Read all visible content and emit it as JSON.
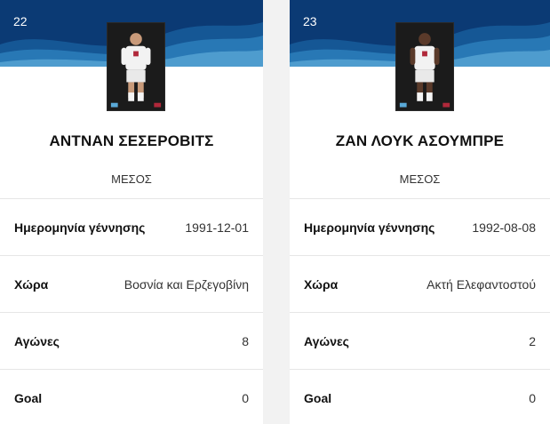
{
  "players": [
    {
      "number": "22",
      "name": "ΑΝΤΝΑΝ ΣΕΣΕΡΟΒΙΤΣ",
      "position": "ΜΕΣΟΣ",
      "stats": [
        {
          "label": "Ημερομηνία γέννησης",
          "value": "1991-12-01"
        },
        {
          "label": "Χώρα",
          "value": "Βοσνία και Ερζεγοβίνη"
        },
        {
          "label": "Αγώνες",
          "value": "8"
        },
        {
          "label": "Goal",
          "value": "0"
        }
      ]
    },
    {
      "number": "23",
      "name": "ΖΑΝ ΛΟΥΚ ΑΣΟΥΜΠΡΕ",
      "position": "ΜΕΣΟΣ",
      "stats": [
        {
          "label": "Ημερομηνία γέννησης",
          "value": "1992-08-08"
        },
        {
          "label": "Χώρα",
          "value": "Ακτή Ελεφαντοστού"
        },
        {
          "label": "Αγώνες",
          "value": "2"
        },
        {
          "label": "Goal",
          "value": "0"
        }
      ]
    }
  ],
  "colors": {
    "banner": "#0b3a74",
    "background": "#f2f2f2"
  }
}
